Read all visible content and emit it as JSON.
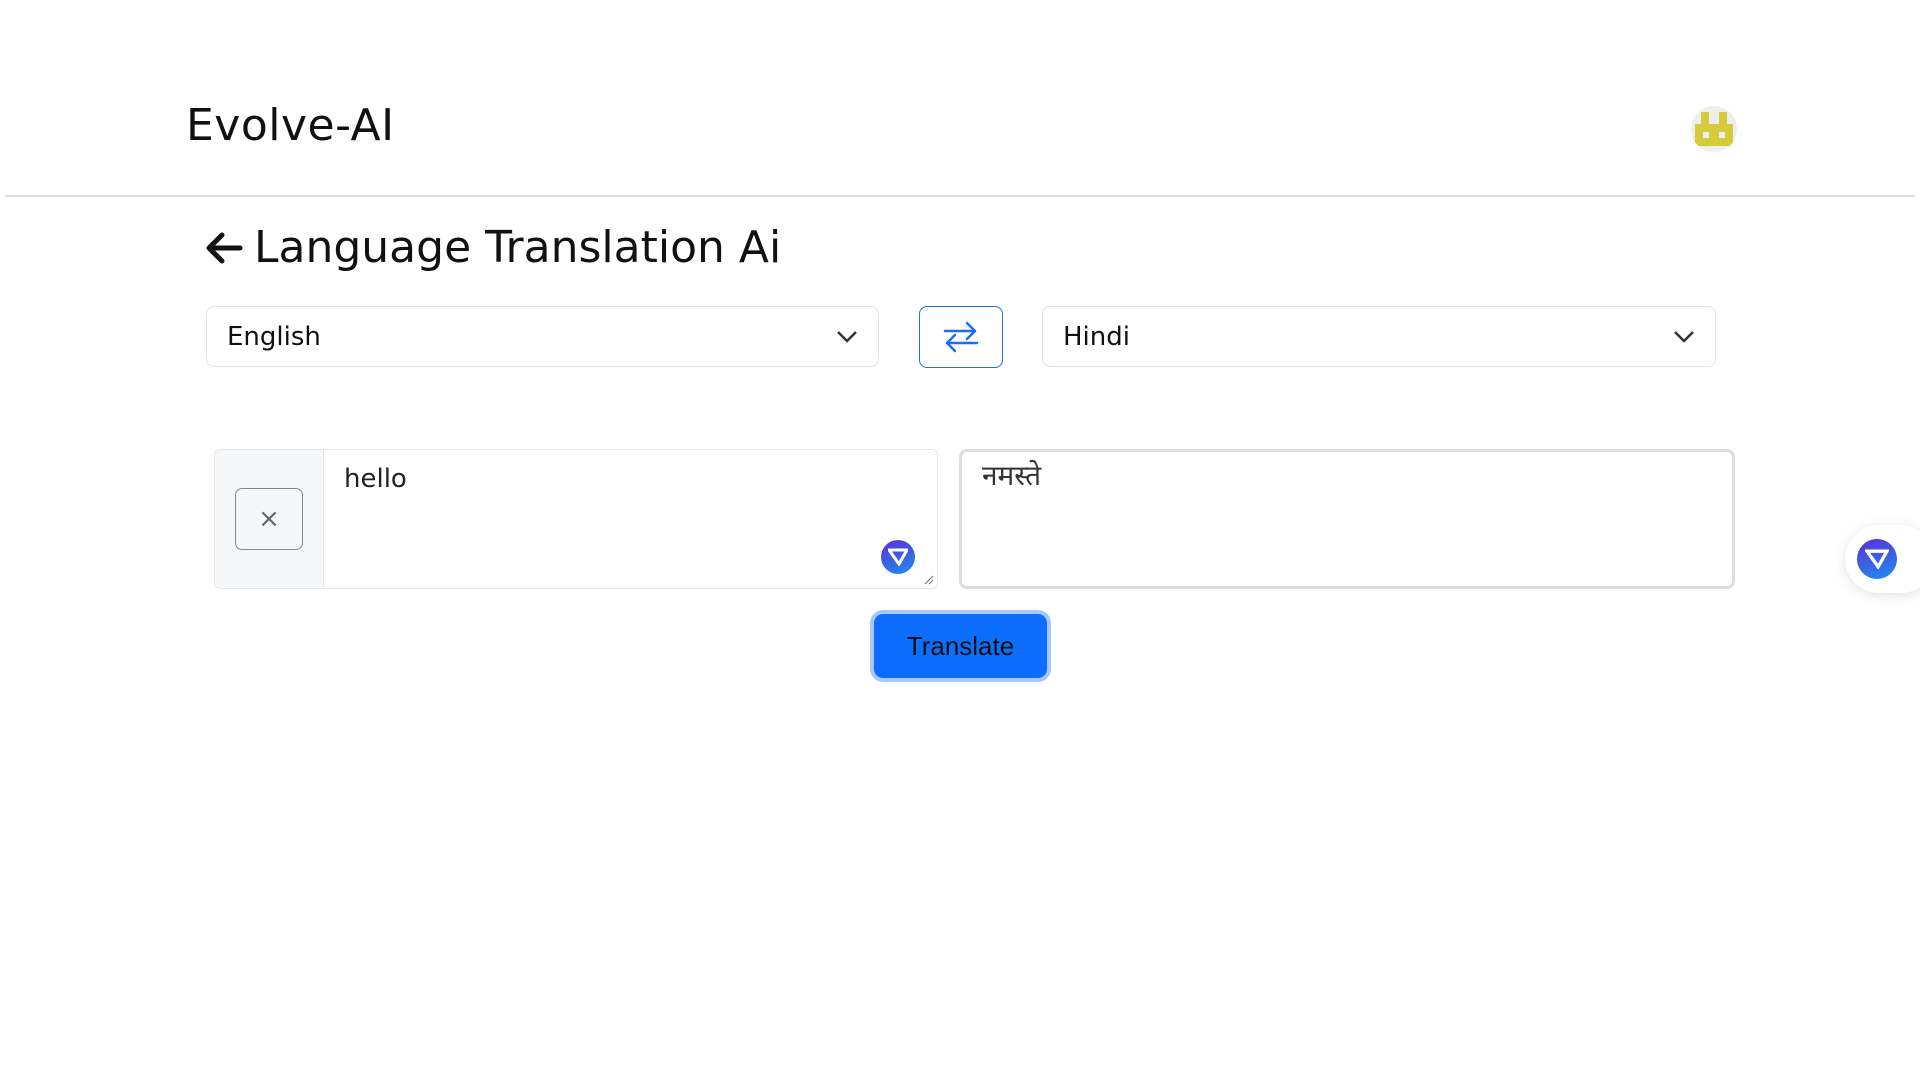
{
  "header": {
    "brand": "Evolve-AI",
    "avatar_icon": "pixel-avatar-icon"
  },
  "page": {
    "title": "Language Translation Ai",
    "back_icon": "arrow-left-icon"
  },
  "source_language": {
    "selected": "English"
  },
  "target_language": {
    "selected": "Hindi"
  },
  "swap": {
    "icon": "swap-arrows-icon"
  },
  "input": {
    "value": "hello",
    "clear_label": "×"
  },
  "output": {
    "value": "नमस्ते"
  },
  "actions": {
    "translate_label": "Translate"
  },
  "colors": {
    "accent": "#0d6efd",
    "avatar": "#d4cc3a"
  }
}
